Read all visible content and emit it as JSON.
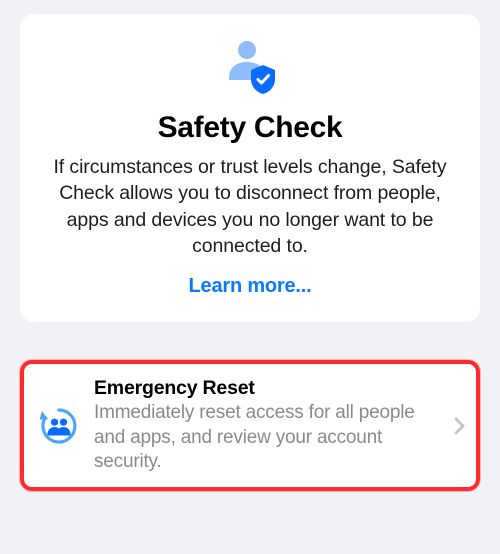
{
  "header": {
    "title": "Safety Check",
    "description": "If circumstances or trust levels change, Safety Check allows you to disconnect from people, apps and devices you no longer want to be connected to.",
    "learn_more": "Learn more..."
  },
  "option": {
    "title": "Emergency Reset",
    "subtitle": "Immediately reset access for all people and apps, and review your account security."
  },
  "colors": {
    "link": "#0a7aff",
    "highlight_border": "#ff2b2b",
    "icon_light": "#8fbdff",
    "icon_dark": "#0a6cff"
  }
}
